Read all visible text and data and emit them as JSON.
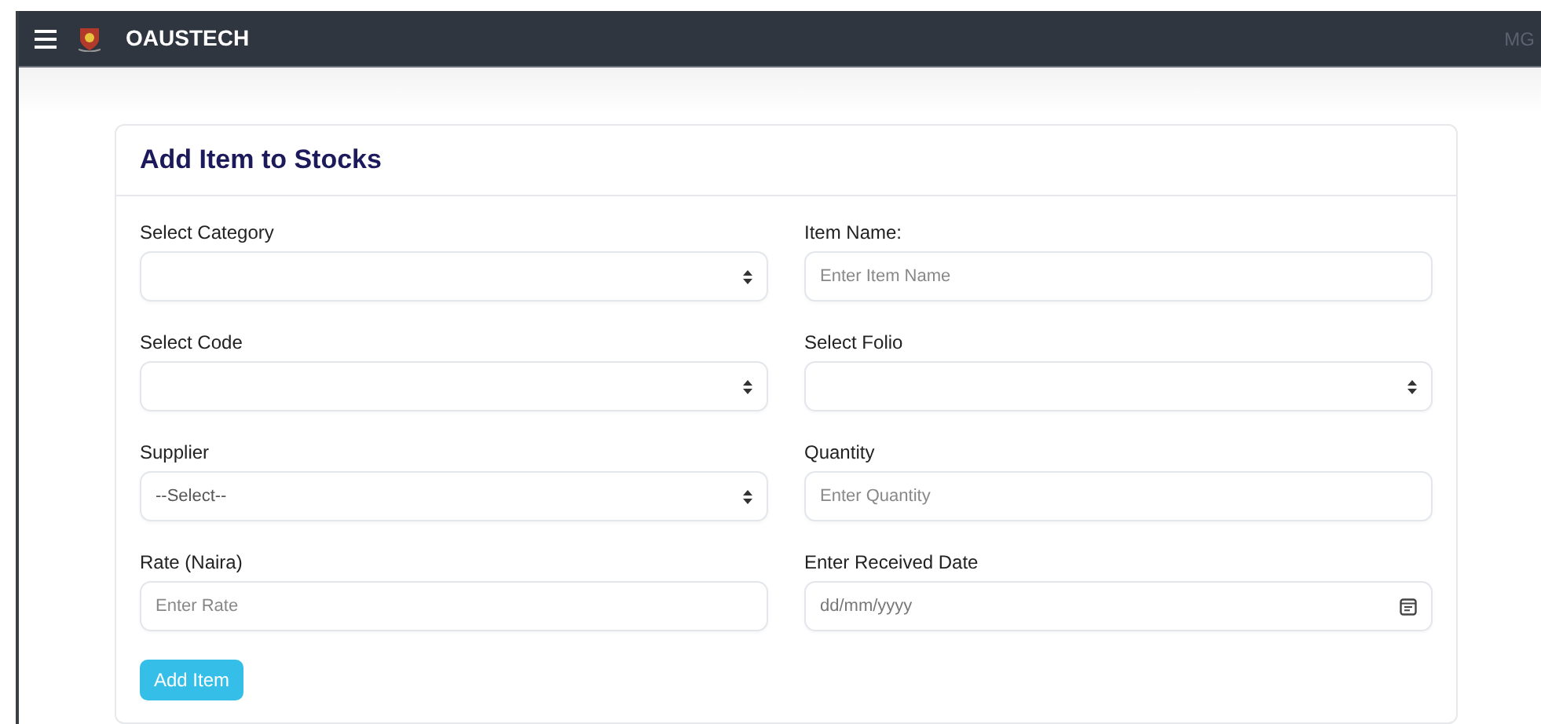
{
  "navbar": {
    "brand": "OAUSTECH",
    "user": "MG"
  },
  "card": {
    "title": "Add Item to Stocks",
    "fields": [
      {
        "label": "Select Category",
        "kind": "select"
      },
      {
        "label": "Item Name:",
        "kind": "text",
        "placeholder": "Enter Item Name"
      },
      {
        "label": "Select Code",
        "kind": "select"
      },
      {
        "label": "Select Folio",
        "kind": "select"
      },
      {
        "label": "Supplier",
        "kind": "select",
        "value": "--Select--"
      },
      {
        "label": "Quantity",
        "kind": "text",
        "placeholder": "Enter Quantity"
      },
      {
        "label": "Rate (Naira)",
        "kind": "text",
        "placeholder": "Enter Rate"
      },
      {
        "label": "Enter Received Date",
        "kind": "date",
        "placeholder": "dd/mm/yyyy"
      }
    ],
    "submit": "Add Item"
  }
}
